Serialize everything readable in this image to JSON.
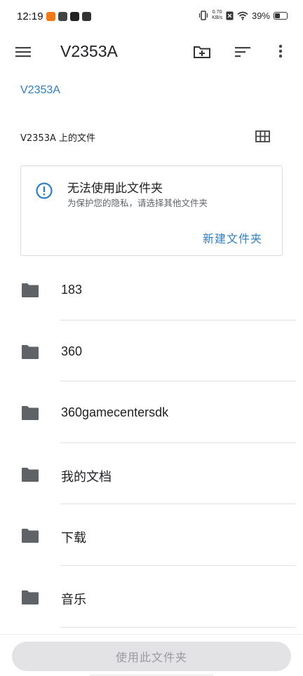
{
  "status_bar": {
    "time": "12:19",
    "net_speed_value": "0.70",
    "net_speed_unit": "KB/s",
    "battery_percent": "39%",
    "battery_level": 0.39
  },
  "app_bar": {
    "title": "V2353A",
    "icons": [
      "menu-icon",
      "new-folder-icon",
      "sort-icon",
      "more-vert-icon"
    ]
  },
  "breadcrumb": "V2353A",
  "section": {
    "title": "V2353A 上的文件",
    "view_icon": "grid-view-icon"
  },
  "warning_card": {
    "icon": "info-icon",
    "title": "无法使用此文件夹",
    "subtitle": "为保护您的隐私，请选择其他文件夹",
    "action": "新建文件夹",
    "accent_color": "#2f7fc1"
  },
  "folders": [
    {
      "name": "183"
    },
    {
      "name": "360"
    },
    {
      "name": "360gamecentersdk"
    },
    {
      "name": "我的文档"
    },
    {
      "name": "下载"
    },
    {
      "name": "音乐"
    }
  ],
  "bottom": {
    "button_label": "使用此文件夹"
  }
}
